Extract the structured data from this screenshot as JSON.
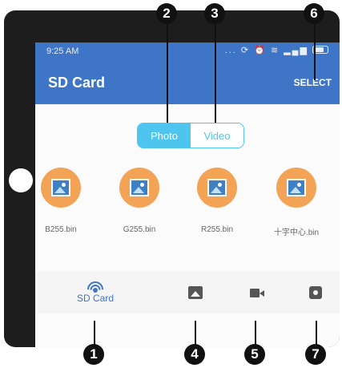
{
  "status_bar": {
    "time": "9:25 AM"
  },
  "app_bar": {
    "title": "SD Card",
    "select_label": "SELECT"
  },
  "media_toggle": {
    "photo_label": "Photo",
    "video_label": "Video",
    "selected": "Photo"
  },
  "files": [
    {
      "name": "B255.bin"
    },
    {
      "name": "G255.bin"
    },
    {
      "name": "R255.bin"
    },
    {
      "name": "十字中心.bin"
    }
  ],
  "bottom_nav": {
    "sd_card_label": "SD Card"
  },
  "callouts": [
    "1",
    "2",
    "3",
    "4",
    "5",
    "6",
    "7"
  ],
  "colors": {
    "primary": "#3f75c6",
    "accent": "#4dc5ee",
    "thumb": "#f2a356"
  }
}
